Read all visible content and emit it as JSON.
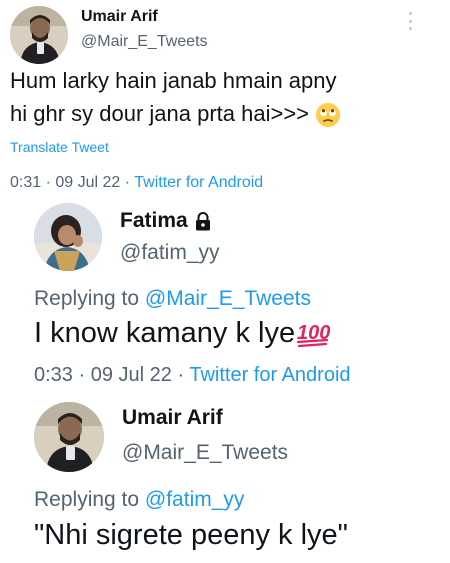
{
  "tweet1": {
    "name": "Umair Arif",
    "handle": "@Mair_E_Tweets",
    "text_line1": "Hum larky hain janab hmain apny",
    "text_line2": "hi ghr sy dour jana prta hai>>>",
    "emoji": "face-with-rolling-eyes",
    "translate_label": "Translate Tweet",
    "time": "0:31",
    "date": "09 Jul 22",
    "source": "Twitter for Android"
  },
  "reply1": {
    "name": "Fatima",
    "locked_icon": "lock-icon",
    "handle": "@fatim_yy",
    "replying_prefix": "Replying to",
    "replying_to": "@Mair_E_Tweets",
    "text": "I know kamany k lye",
    "emoji": "hundred-points",
    "time": "0:33",
    "date": "09 Jul 22",
    "source": "Twitter for Android"
  },
  "reply2": {
    "name": "Umair Arif",
    "handle": "@Mair_E_Tweets",
    "replying_prefix": "Replying to",
    "replying_to": "@fatim_yy",
    "text": "\"Nhi sigrete peeny k lye\""
  },
  "separator": "·",
  "colors": {
    "text": "#0f1419",
    "secondary": "#536471",
    "link": "#1d9bf0",
    "hundred": "#e0245e"
  }
}
